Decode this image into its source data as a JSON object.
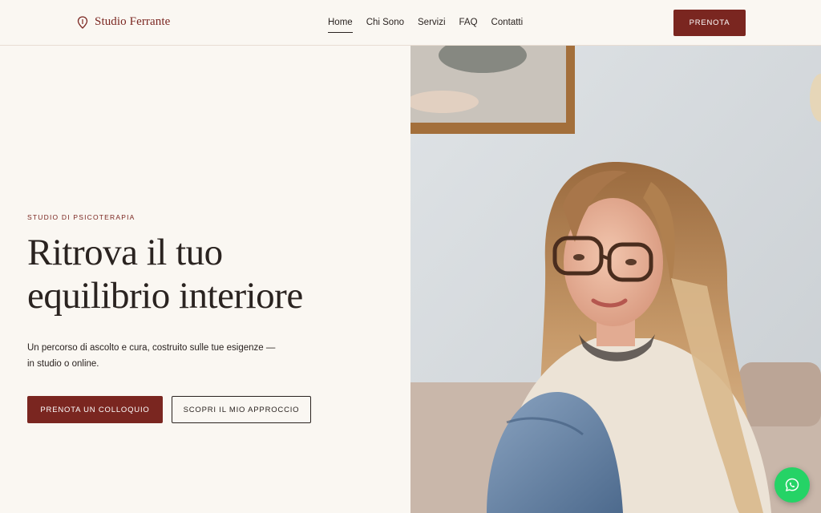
{
  "brand": {
    "name": "Studio Ferrante",
    "logo_icon": "location-pin-icon",
    "accent_color": "#7a2620"
  },
  "nav": {
    "items": [
      {
        "label": "Home",
        "active": true
      },
      {
        "label": "Chi Sono",
        "active": false
      },
      {
        "label": "Servizi",
        "active": false
      },
      {
        "label": "FAQ",
        "active": false
      },
      {
        "label": "Contatti",
        "active": false
      }
    ],
    "cta_label": "PRENOTA"
  },
  "hero": {
    "eyebrow": "STUDIO DI PSICOTERAPIA",
    "title_line1": "Ritrova il tuo",
    "title_line2": "equilibrio interiore",
    "subtitle": "Un percorso di ascolto e cura, costruito sulle tue esigenze — in studio o online.",
    "primary_button": "PRENOTA UN COLLOQUIO",
    "secondary_button": "SCOPRI IL MIO APPROCCIO",
    "image_subject": "portrait-photo"
  },
  "floating": {
    "icon": "whatsapp-icon",
    "color": "#25d366"
  }
}
